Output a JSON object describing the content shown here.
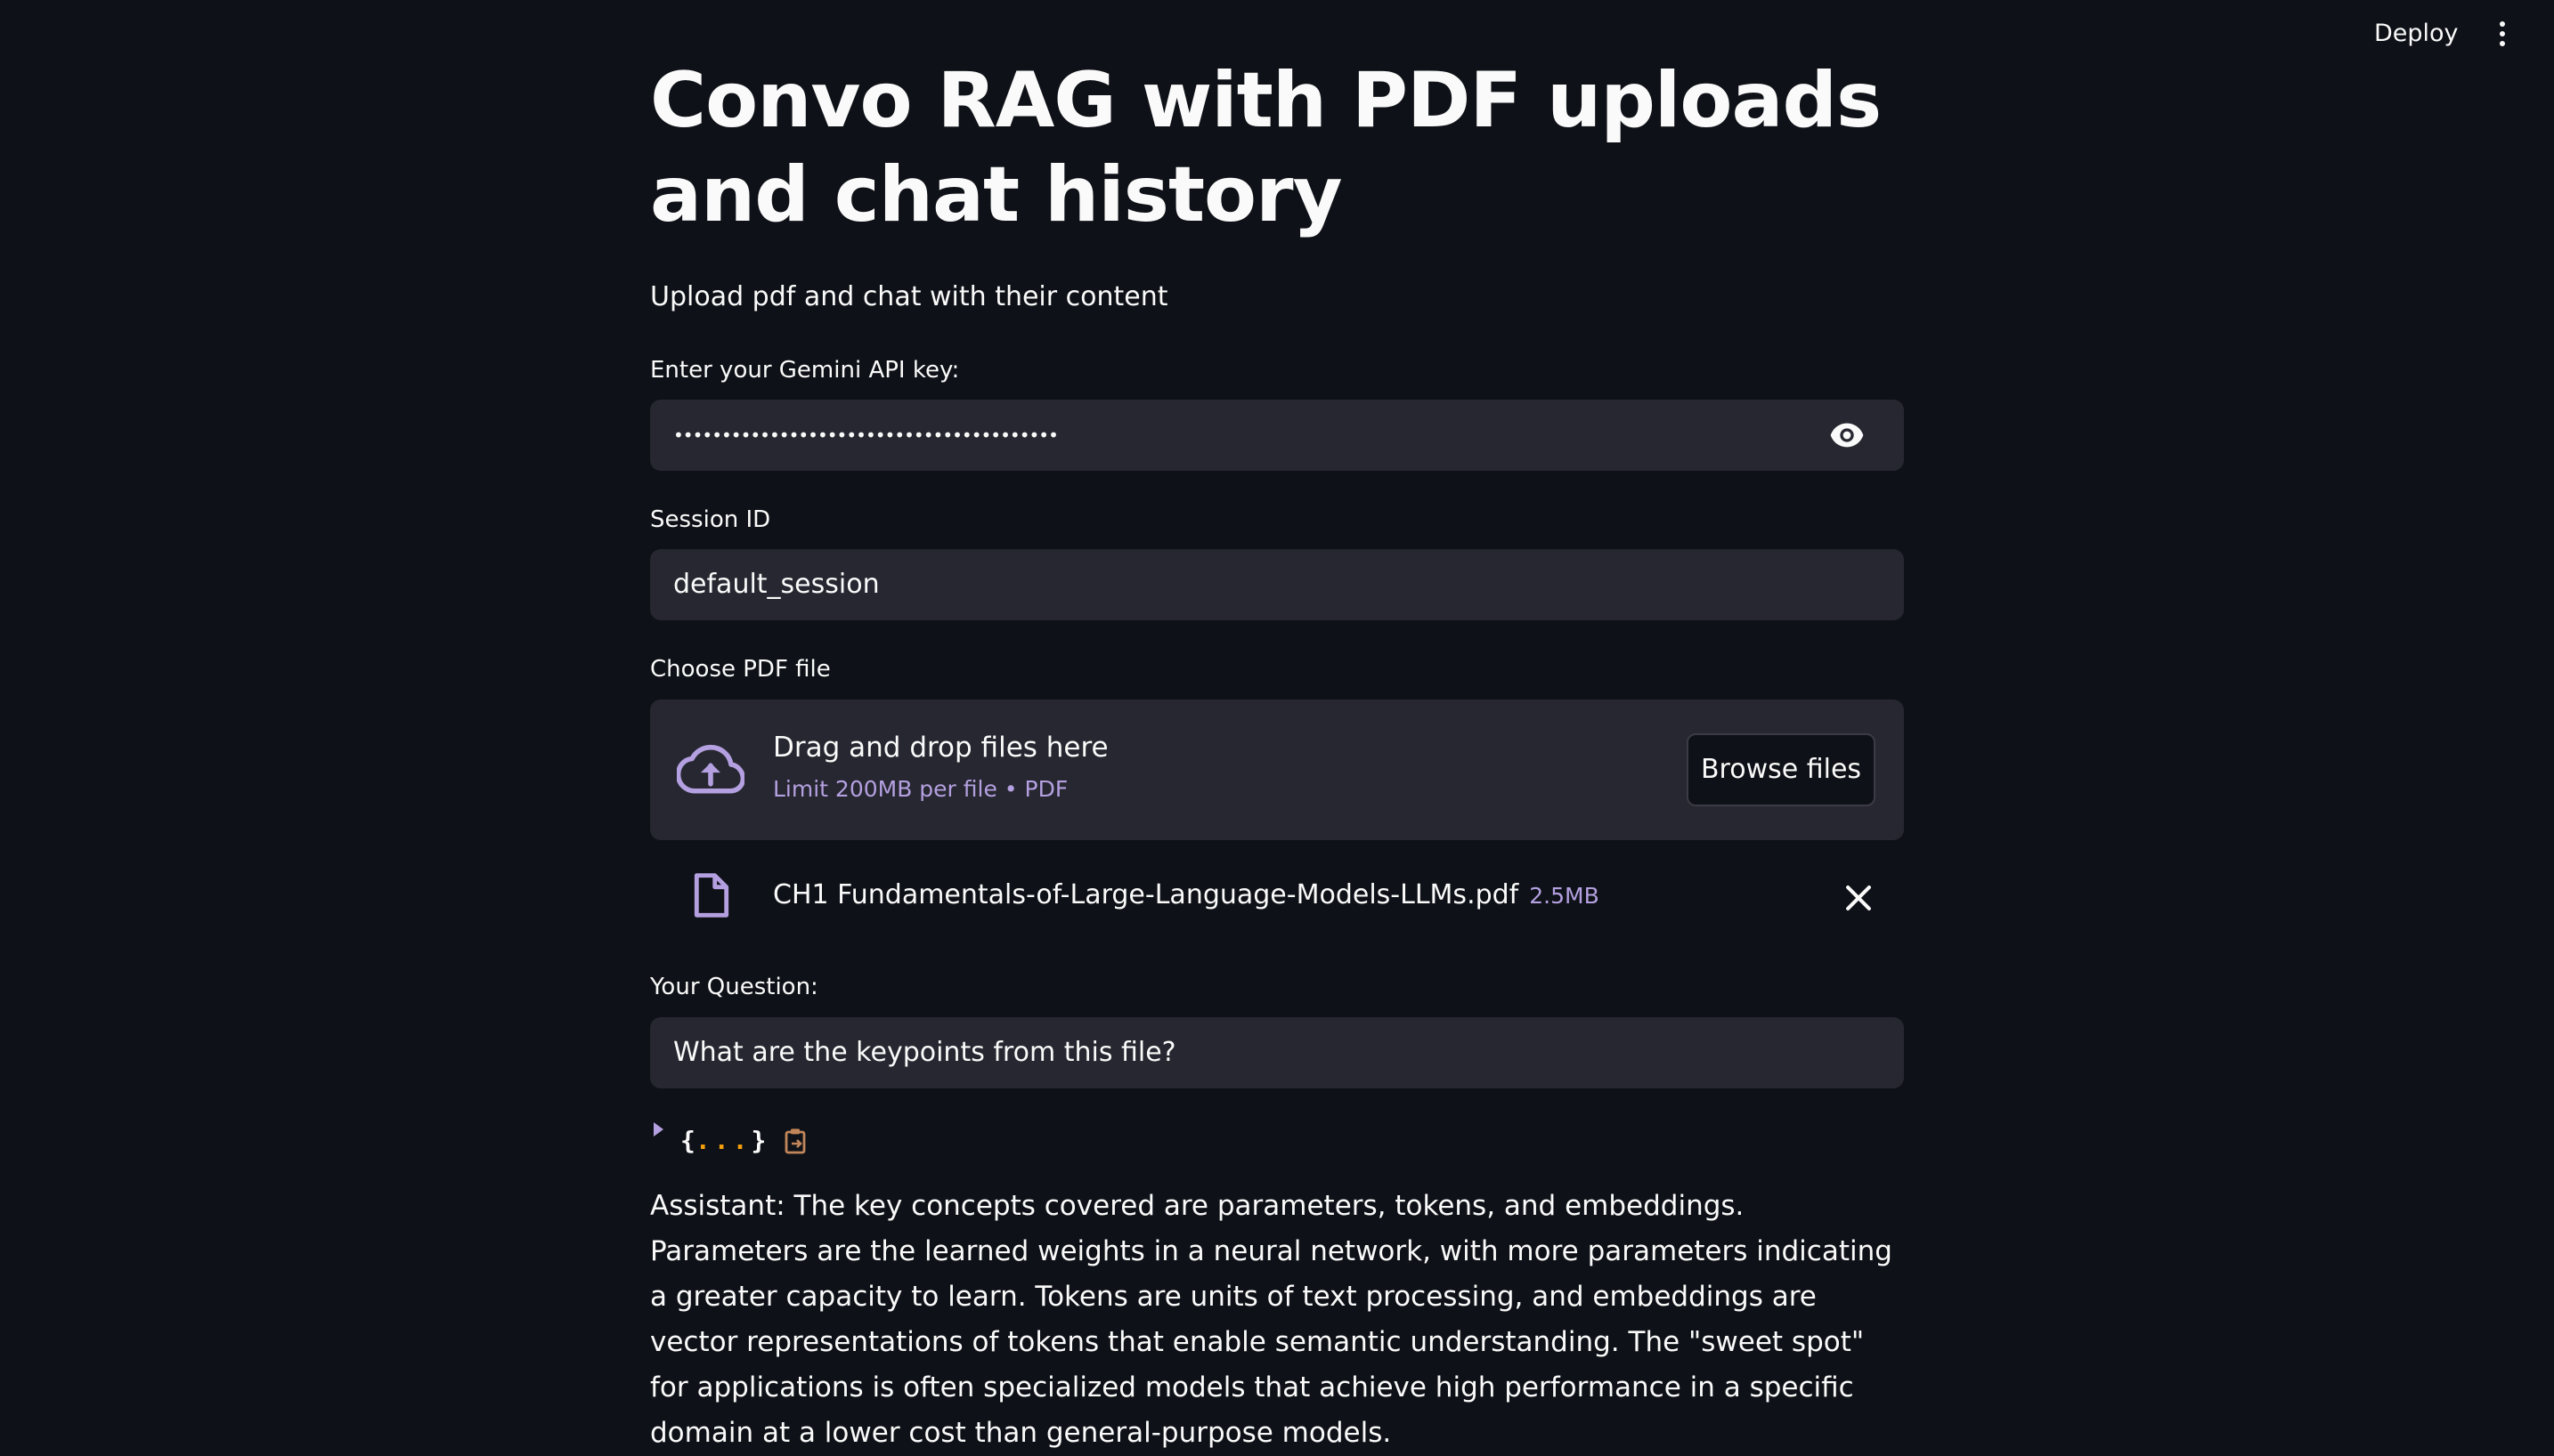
{
  "header": {
    "deploy_label": "Deploy",
    "menu_icon": "kebab-menu-icon"
  },
  "page": {
    "title": "Convo RAG with PDF uploads and chat history",
    "subtitle": "Upload pdf and chat with their content"
  },
  "api_key": {
    "label": "Enter your Gemini API key:",
    "value": "••••••••••••••••••••••••••••••••••••••••",
    "toggle_icon": "eye-icon"
  },
  "session": {
    "label": "Session ID",
    "value": "default_session"
  },
  "uploader": {
    "label": "Choose PDF file",
    "drop_text": "Drag and drop files here",
    "limit_text": "Limit 200MB per file • PDF",
    "browse_label": "Browse files",
    "icon": "cloud-upload-icon",
    "file": {
      "name": "CH1 Fundamentals-of-Large-Language-Models-LLMs.pdf",
      "size": "2.5MB",
      "icon": "file-icon",
      "remove_icon": "close-icon"
    }
  },
  "question": {
    "label": "Your Question:",
    "value": "What are the keypoints from this file?"
  },
  "json_viewer": {
    "open_brace": "{",
    "ellipsis": "...",
    "close_brace": "}",
    "copy_icon": "clipboard-icon"
  },
  "answer": {
    "text": "Assistant: The key concepts covered are parameters, tokens, and embeddings. Parameters are the learned weights in a neural network, with more parameters indicating a greater capacity to learn. Tokens are units of text processing, and embeddings are vector representations of tokens that enable semantic understanding. The \"sweet spot\" for applications is often specialized models that achieve high performance in a specific domain at a lower cost than general-purpose models."
  },
  "colors": {
    "background": "#0e1117",
    "input_background": "#262730",
    "text": "#fafafa",
    "accent": "#b4a0e0",
    "ellipsis": "#f59e0b"
  }
}
